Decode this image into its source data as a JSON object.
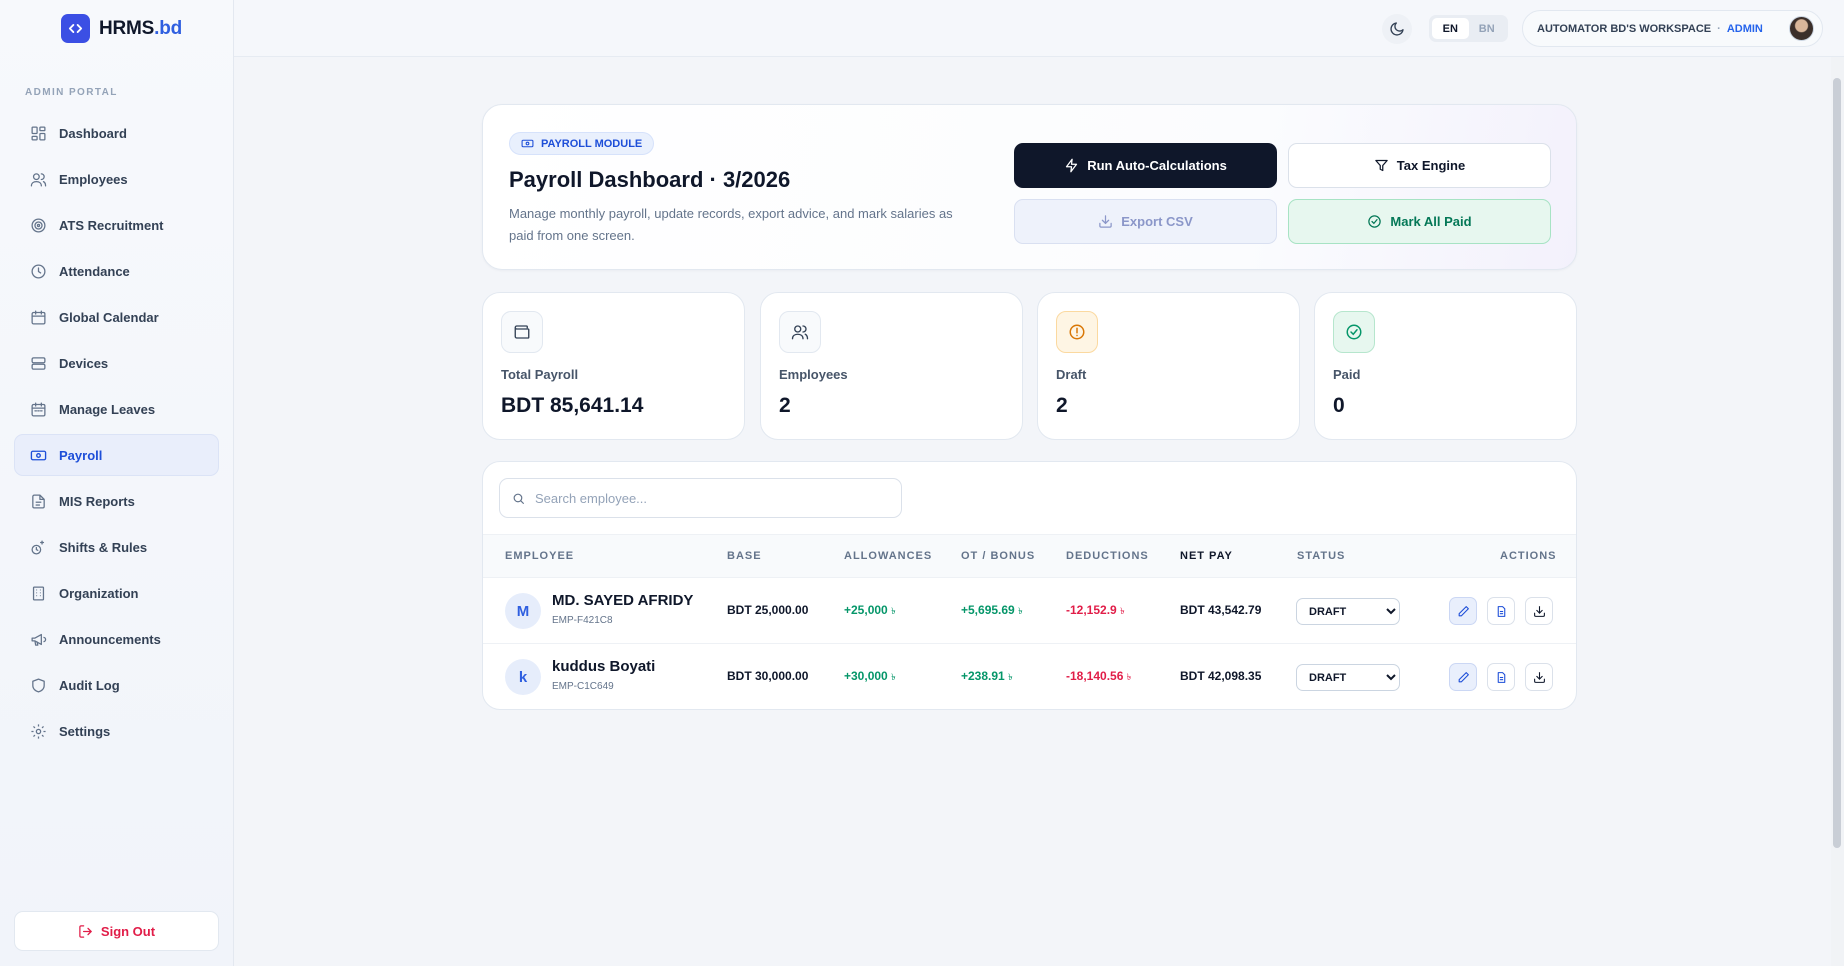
{
  "brand": {
    "name": "HRMS",
    "tld": ".bd"
  },
  "sidebar": {
    "section_label": "ADMIN PORTAL",
    "items": [
      {
        "label": "Dashboard",
        "icon": "dashboard-icon"
      },
      {
        "label": "Employees",
        "icon": "users-icon"
      },
      {
        "label": "ATS Recruitment",
        "icon": "target-icon"
      },
      {
        "label": "Attendance",
        "icon": "clock-icon"
      },
      {
        "label": "Global Calendar",
        "icon": "calendar-icon"
      },
      {
        "label": "Devices",
        "icon": "server-icon"
      },
      {
        "label": "Manage Leaves",
        "icon": "calendar-days-icon"
      },
      {
        "label": "Payroll",
        "icon": "banknote-icon",
        "active": true
      },
      {
        "label": "MIS Reports",
        "icon": "file-icon"
      },
      {
        "label": "Shifts & Rules",
        "icon": "rules-icon"
      },
      {
        "label": "Organization",
        "icon": "building-icon"
      },
      {
        "label": "Announcements",
        "icon": "megaphone-icon"
      },
      {
        "label": "Audit Log",
        "icon": "shield-icon"
      },
      {
        "label": "Settings",
        "icon": "gear-icon"
      }
    ],
    "sign_out": "Sign Out"
  },
  "topbar": {
    "lang_en": "EN",
    "lang_bn": "BN",
    "workspace": "AUTOMATOR BD'S WORKSPACE",
    "separator": "·",
    "role": "ADMIN"
  },
  "hero": {
    "pill": "PAYROLL MODULE",
    "title": "Payroll Dashboard · 3/2026",
    "description": "Manage monthly payroll, update records, export advice, and mark salaries as paid from one screen.",
    "buttons": {
      "run": "Run Auto-Calculations",
      "tax": "Tax Engine",
      "export": "Export CSV",
      "mark_paid": "Mark All Paid"
    }
  },
  "stats": [
    {
      "label": "Total Payroll",
      "value": "BDT 85,641.14",
      "icon": "wallet-icon"
    },
    {
      "label": "Employees",
      "value": "2",
      "icon": "users-icon"
    },
    {
      "label": "Draft",
      "value": "2",
      "icon": "alert-circle-icon"
    },
    {
      "label": "Paid",
      "value": "0",
      "icon": "check-circle-icon"
    }
  ],
  "table": {
    "search_placeholder": "Search employee...",
    "columns": [
      "EMPLOYEE",
      "BASE",
      "ALLOWANCES",
      "OT / BONUS",
      "DEDUCTIONS",
      "NET PAY",
      "STATUS",
      "ACTIONS"
    ],
    "currency_symbol": "৳",
    "rows": [
      {
        "initial": "M",
        "name": "MD. SAYED AFRIDY",
        "id": "EMP-F421C8",
        "base": "BDT 25,000.00",
        "allowances": "+25,000",
        "ot_bonus": "+5,695.69",
        "deductions": "-12,152.9",
        "net_pay": "BDT 43,542.79",
        "status": "DRAFT"
      },
      {
        "initial": "k",
        "name": "kuddus Boyati",
        "id": "EMP-C1C649",
        "base": "BDT 30,000.00",
        "allowances": "+30,000",
        "ot_bonus": "+238.91",
        "deductions": "-18,140.56",
        "net_pay": "BDT 42,098.35",
        "status": "DRAFT"
      }
    ],
    "status_options": [
      "DRAFT"
    ]
  },
  "colors": {
    "accent": "#2f5fe0",
    "primary_dark": "#0f172a",
    "positive": "#059669",
    "negative": "#e11d48"
  }
}
